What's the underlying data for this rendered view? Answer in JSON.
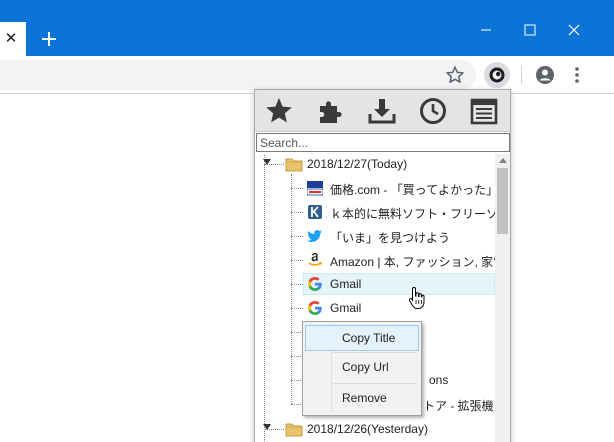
{
  "browser": {
    "tab_close_glyph": "✕",
    "new_tab_glyph": "+",
    "accent_color": "#0b74d6"
  },
  "popup": {
    "toolbar_icons": [
      "star-icon",
      "puzzle-icon",
      "download-icon",
      "clock-icon",
      "notes-icon"
    ],
    "search_placeholder": "Search...",
    "folders": [
      {
        "label": "2018/12/27(Today)",
        "items": [
          {
            "label": "価格.com - 「買ってよかった」",
            "icon": "kakaku-icon"
          },
          {
            "label": "ｋ本的に無料ソフト・フリーソ",
            "icon": "k-icon"
          },
          {
            "label": "「いま」を見つけよう",
            "icon": "twitter-bird-icon"
          },
          {
            "label": "Amazon | 本, ファッション, 家電",
            "icon": "amazon-icon"
          },
          {
            "label": "Gmail",
            "icon": "google-icon"
          },
          {
            "label": "Gmail",
            "icon": "google-icon"
          },
          {
            "label": "",
            "icon": "google-icon"
          },
          {
            "label": "",
            "icon": "google-icon"
          },
          {
            "label": "ons",
            "icon": "chrome-icon"
          },
          {
            "label": "トア - 拡張機",
            "icon": "chrome-icon"
          }
        ]
      },
      {
        "label": "2018/12/26(Yesterday)",
        "items": []
      }
    ]
  },
  "context_menu": {
    "items": [
      "Copy Title",
      "Copy Url",
      "Remove"
    ]
  }
}
